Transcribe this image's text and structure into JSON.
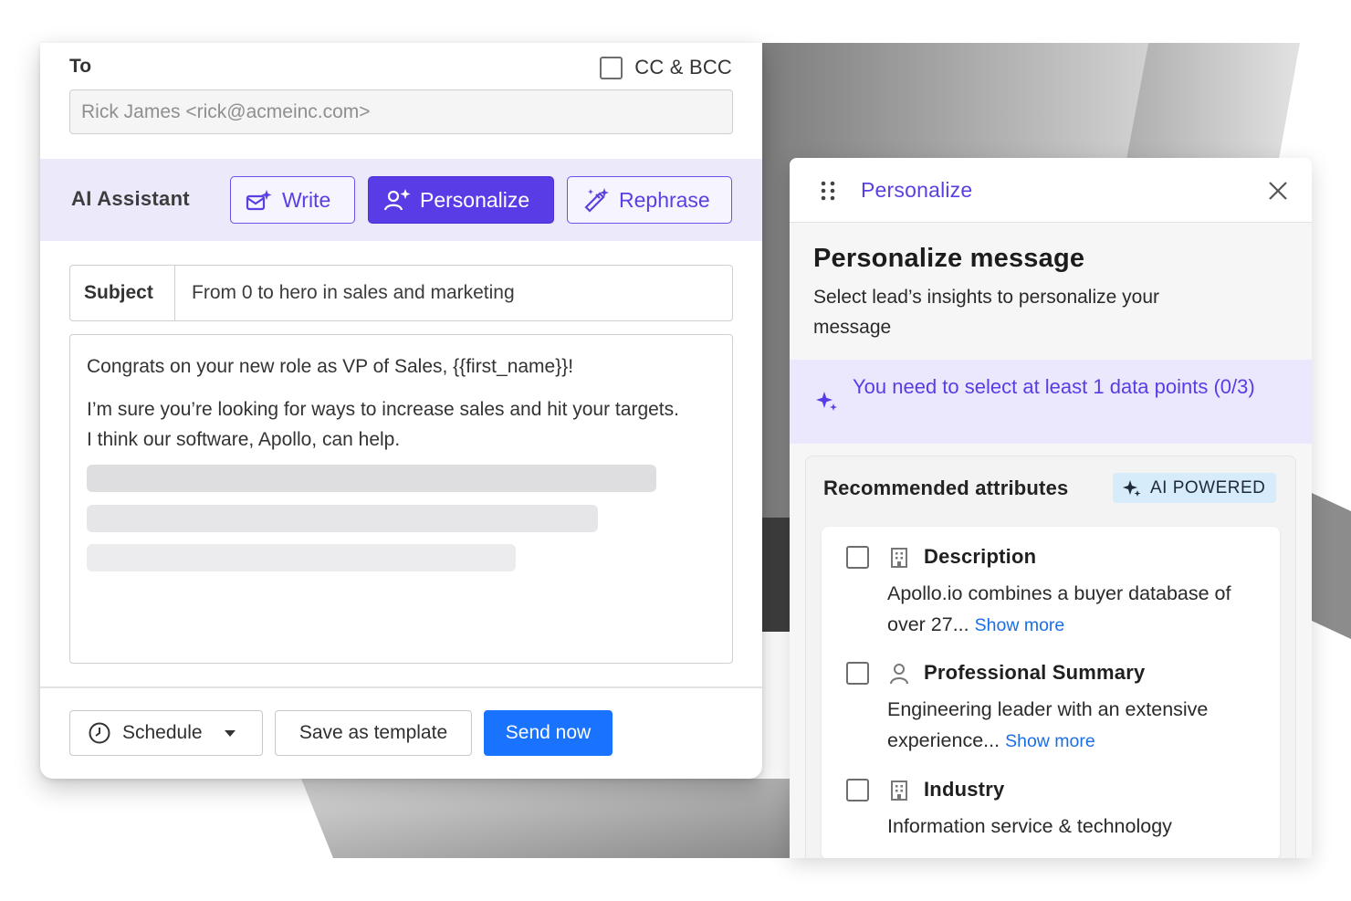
{
  "composer": {
    "to_label": "To",
    "cc_bcc_label": "CC & BCC",
    "to_placeholder": "Rick James <rick@acmeinc.com>",
    "ai_assistant_label": "AI Assistant",
    "ai_buttons": {
      "write": "Write",
      "personalize": "Personalize",
      "rephrase": "Rephrase"
    },
    "subject_label": "Subject",
    "subject_value": "From 0 to hero in sales and marketing",
    "body_line_1": "Congrats on your new role as VP of Sales, {{first_name}}!",
    "body_line_2": "I’m sure you’re looking for ways to increase sales and hit your targets. I think our software, Apollo, can help.",
    "footer": {
      "schedule_label": "Schedule",
      "save_template_label": "Save as template",
      "send_now_label": "Send now"
    }
  },
  "panel": {
    "tab_label": "Personalize",
    "title": "Personalize message",
    "subtitle": "Select lead’s insights to personalize your message",
    "alert_text": "You need to select at least 1 data points (0/3)",
    "recommended_title": "Recommended attributes",
    "ai_badge": "AI POWERED",
    "show_more_label": "Show more",
    "attributes": [
      {
        "icon": "building-icon",
        "title": "Description",
        "text": "Apollo.io combines a buyer database of over 27...",
        "show_more": true
      },
      {
        "icon": "person-icon",
        "title": "Professional Summary",
        "text": "Engineering leader with an extensive experience...",
        "show_more": true
      },
      {
        "icon": "building-icon",
        "title": "Industry",
        "text": "Information service & technology",
        "show_more": false
      }
    ]
  },
  "colors": {
    "accent_purple": "#5a3ce6",
    "ai_bar_bg": "#ece9fb",
    "send_blue": "#1a73ff",
    "link_blue": "#1a6fe6",
    "badge_bg": "#d6ecfb"
  }
}
